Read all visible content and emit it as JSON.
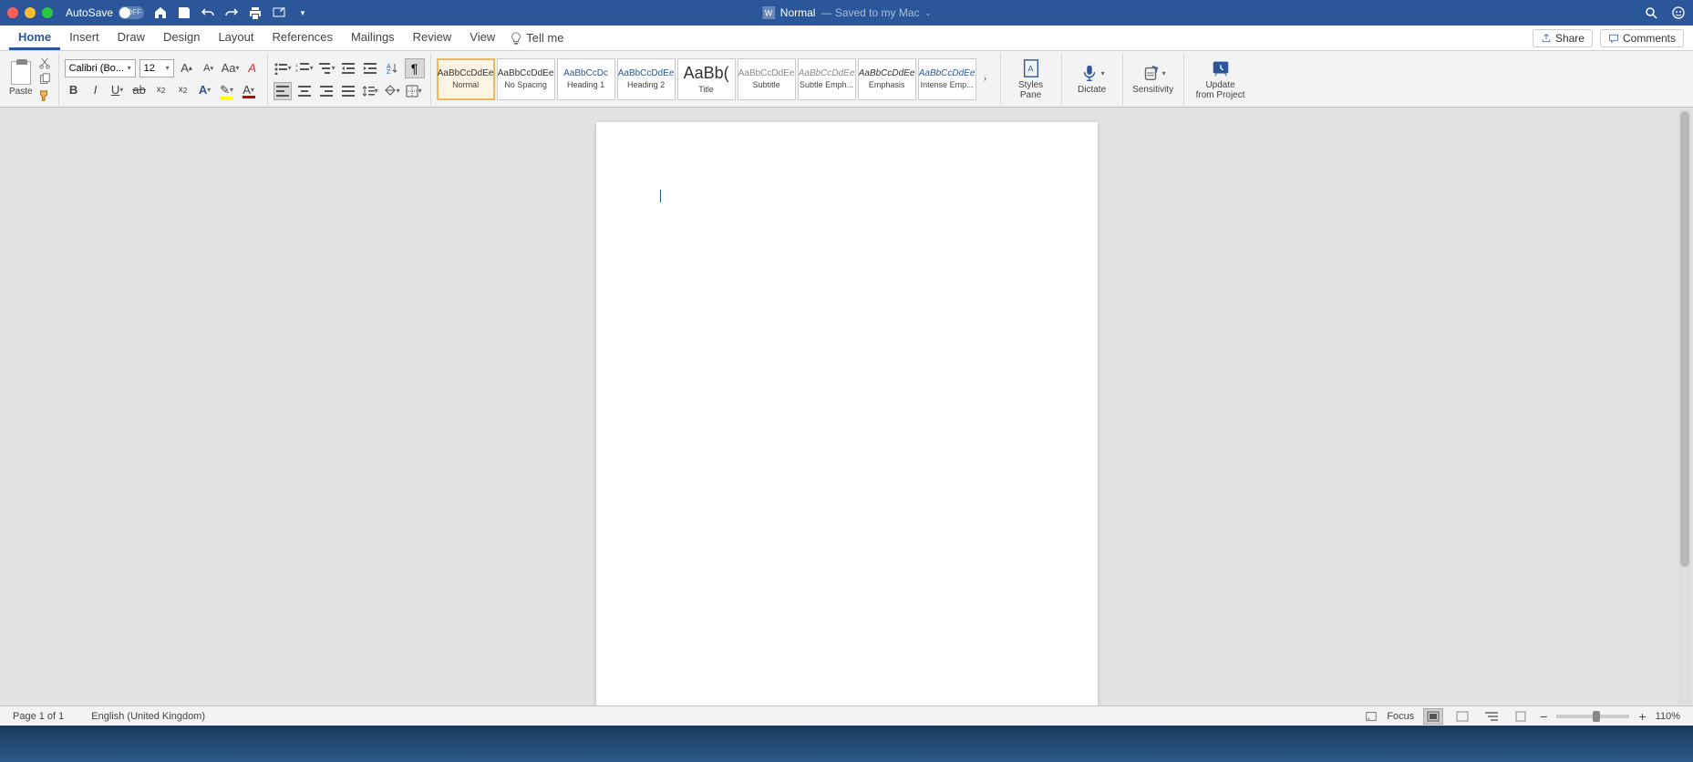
{
  "titlebar": {
    "autosave_label": "AutoSave",
    "autosave_state": "OFF",
    "doc_name": "Normal",
    "doc_status": "— Saved to my Mac"
  },
  "tabs": [
    "Home",
    "Insert",
    "Draw",
    "Design",
    "Layout",
    "References",
    "Mailings",
    "Review",
    "View"
  ],
  "active_tab": "Home",
  "tellme": "Tell me",
  "share": "Share",
  "comments": "Comments",
  "clipboard": {
    "paste": "Paste"
  },
  "font": {
    "name": "Calibri (Bo...",
    "size": "12"
  },
  "styles": [
    {
      "preview": "AaBbCcDdEe",
      "label": "Normal",
      "cls": "",
      "selected": true
    },
    {
      "preview": "AaBbCcDdEe",
      "label": "No Spacing",
      "cls": ""
    },
    {
      "preview": "AaBbCcDc",
      "label": "Heading 1",
      "cls": "blue"
    },
    {
      "preview": "AaBbCcDdEe",
      "label": "Heading 2",
      "cls": "blue"
    },
    {
      "preview": "AaBb(",
      "label": "Title",
      "cls": "big"
    },
    {
      "preview": "AaBbCcDdEe",
      "label": "Subtitle",
      "cls": "gray"
    },
    {
      "preview": "AaBbCcDdEe",
      "label": "Subtle Emph...",
      "cls": "gray italic"
    },
    {
      "preview": "AaBbCcDdEe",
      "label": "Emphasis",
      "cls": "italic"
    },
    {
      "preview": "AaBbCcDdEe",
      "label": "Intense Emp...",
      "cls": "blue italic"
    }
  ],
  "ribbon_right": {
    "styles_pane": "Styles\nPane",
    "dictate": "Dictate",
    "sensitivity": "Sensitivity",
    "update": "Update\nfrom Project"
  },
  "status": {
    "page": "Page 1 of 1",
    "lang": "English (United Kingdom)",
    "focus": "Focus",
    "zoom": "110%"
  }
}
